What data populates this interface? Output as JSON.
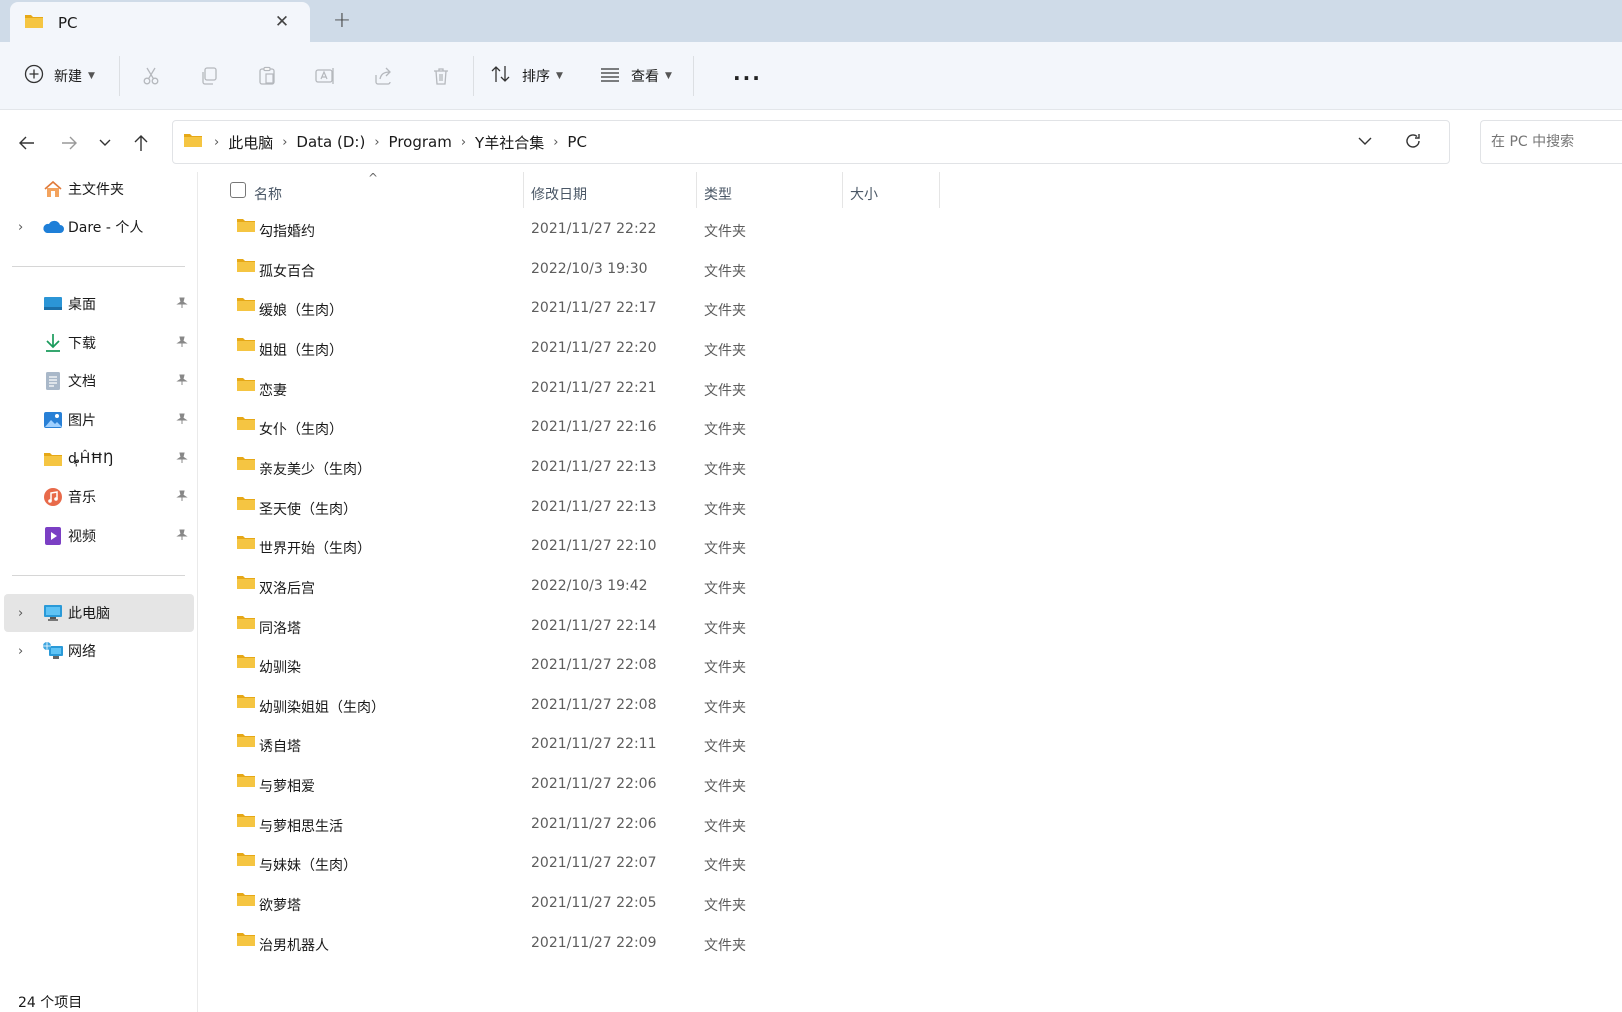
{
  "tabs": [
    {
      "title": "PC"
    }
  ],
  "tab_close_glyph": "✕",
  "new_tab_glyph": "+",
  "toolbar": {
    "new_label": "新建",
    "sort_label": "排序",
    "view_label": "查看",
    "more_glyph": "···",
    "icons": [
      "cut-icon",
      "copy-icon",
      "paste-icon",
      "rename-icon",
      "share-icon",
      "delete-icon"
    ]
  },
  "breadcrumb": [
    "此电脑",
    "Data (D:)",
    "Program",
    "Y羊社合集",
    "PC"
  ],
  "search": {
    "placeholder": "在 PC 中搜索"
  },
  "sidebar": {
    "top_items": [
      {
        "label": "主文件夹",
        "icon": "home-icon",
        "expandable": false
      },
      {
        "label": "Dare - 个人",
        "icon": "onedrive-cloud-icon",
        "expandable": true
      }
    ],
    "quick_access": [
      {
        "label": "桌面",
        "icon": "desktop-icon"
      },
      {
        "label": "下载",
        "icon": "download-icon"
      },
      {
        "label": "文档",
        "icon": "document-icon"
      },
      {
        "label": "图片",
        "icon": "pictures-icon"
      },
      {
        "label": "ȡ̩ĤĦŊ",
        "icon": "folder-icon"
      },
      {
        "label": "音乐",
        "icon": "music-icon"
      },
      {
        "label": "视频",
        "icon": "video-icon"
      }
    ],
    "bottom_items": [
      {
        "label": "此电脑",
        "icon": "this-pc-icon",
        "selected": true
      },
      {
        "label": "网络",
        "icon": "network-icon",
        "selected": false
      }
    ]
  },
  "columns": {
    "name": "名称",
    "date": "修改日期",
    "type": "类型",
    "size": "大小"
  },
  "files": [
    {
      "name": "勾指婚约",
      "date": "2021/11/27 22:22",
      "type": "文件夹"
    },
    {
      "name": "孤女百合",
      "date": "2022/10/3 19:30",
      "type": "文件夹"
    },
    {
      "name": "缓娘（生肉）",
      "date": "2021/11/27 22:17",
      "type": "文件夹"
    },
    {
      "name": "姐姐（生肉）",
      "date": "2021/11/27 22:20",
      "type": "文件夹"
    },
    {
      "name": "恋妻",
      "date": "2021/11/27 22:21",
      "type": "文件夹"
    },
    {
      "name": "女仆（生肉）",
      "date": "2021/11/27 22:16",
      "type": "文件夹"
    },
    {
      "name": "亲友美少（生肉）",
      "date": "2021/11/27 22:13",
      "type": "文件夹"
    },
    {
      "name": "圣天使（生肉）",
      "date": "2021/11/27 22:13",
      "type": "文件夹"
    },
    {
      "name": "世界开始（生肉）",
      "date": "2021/11/27 22:10",
      "type": "文件夹"
    },
    {
      "name": "双洛后宫",
      "date": "2022/10/3 19:42",
      "type": "文件夹"
    },
    {
      "name": "同洛塔",
      "date": "2021/11/27 22:14",
      "type": "文件夹"
    },
    {
      "name": "幼驯染",
      "date": "2021/11/27 22:08",
      "type": "文件夹"
    },
    {
      "name": "幼驯染姐姐（生肉）",
      "date": "2021/11/27 22:08",
      "type": "文件夹"
    },
    {
      "name": "诱自塔",
      "date": "2021/11/27 22:11",
      "type": "文件夹"
    },
    {
      "name": "与萝相爱",
      "date": "2021/11/27 22:06",
      "type": "文件夹"
    },
    {
      "name": "与萝相思生活",
      "date": "2021/11/27 22:06",
      "type": "文件夹"
    },
    {
      "name": "与妹妹（生肉）",
      "date": "2021/11/27 22:07",
      "type": "文件夹"
    },
    {
      "name": "欲萝塔",
      "date": "2021/11/27 22:05",
      "type": "文件夹"
    },
    {
      "name": "治男机器人",
      "date": "2021/11/27 22:09",
      "type": "文件夹"
    }
  ],
  "status": {
    "item_count": "24 个项目"
  },
  "colors": {
    "folder": "#f5c542",
    "folder_dark": "#e6a817",
    "accent": "#0067c0",
    "selected_bg": "#e5e5e5",
    "titlebar_bg": "#cfdbe8",
    "toolbar_bg": "#f3f6fb"
  }
}
